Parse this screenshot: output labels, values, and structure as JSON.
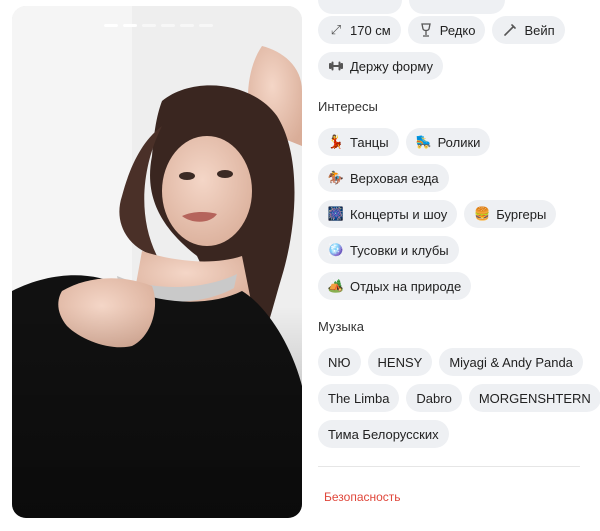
{
  "profile_details": {
    "basics": [
      {
        "icon": "height-arrows-icon",
        "label": "170 см"
      },
      {
        "icon": "wine-glass-icon",
        "label": "Редко"
      },
      {
        "icon": "vape-icon",
        "label": "Вейп"
      },
      {
        "icon": "dumbbell-icon",
        "label": "Держу форму"
      }
    ],
    "interests_title": "Интересы",
    "interests": [
      {
        "emoji": "💃",
        "label": "Танцы"
      },
      {
        "emoji": "🛼",
        "label": "Ролики"
      },
      {
        "emoji": "🏇",
        "label": "Верховая езда"
      },
      {
        "emoji": "🎆",
        "label": "Концерты и шоу"
      },
      {
        "emoji": "🍔",
        "label": "Бургеры"
      },
      {
        "emoji": "🪩",
        "label": "Тусовки и клубы"
      },
      {
        "emoji": "🏕️",
        "label": "Отдых на природе"
      }
    ],
    "music_title": "Музыка",
    "music": [
      "NЮ",
      "HENSY",
      "Miyagi & Andy Panda",
      "The Limba",
      "Dabro",
      "MORGENSHTERN",
      "Тима Белорусских"
    ],
    "safety_link": "Безопасность"
  },
  "colors": {
    "chip_bg": "#eef0f3",
    "safety_red": "#e0473b"
  }
}
